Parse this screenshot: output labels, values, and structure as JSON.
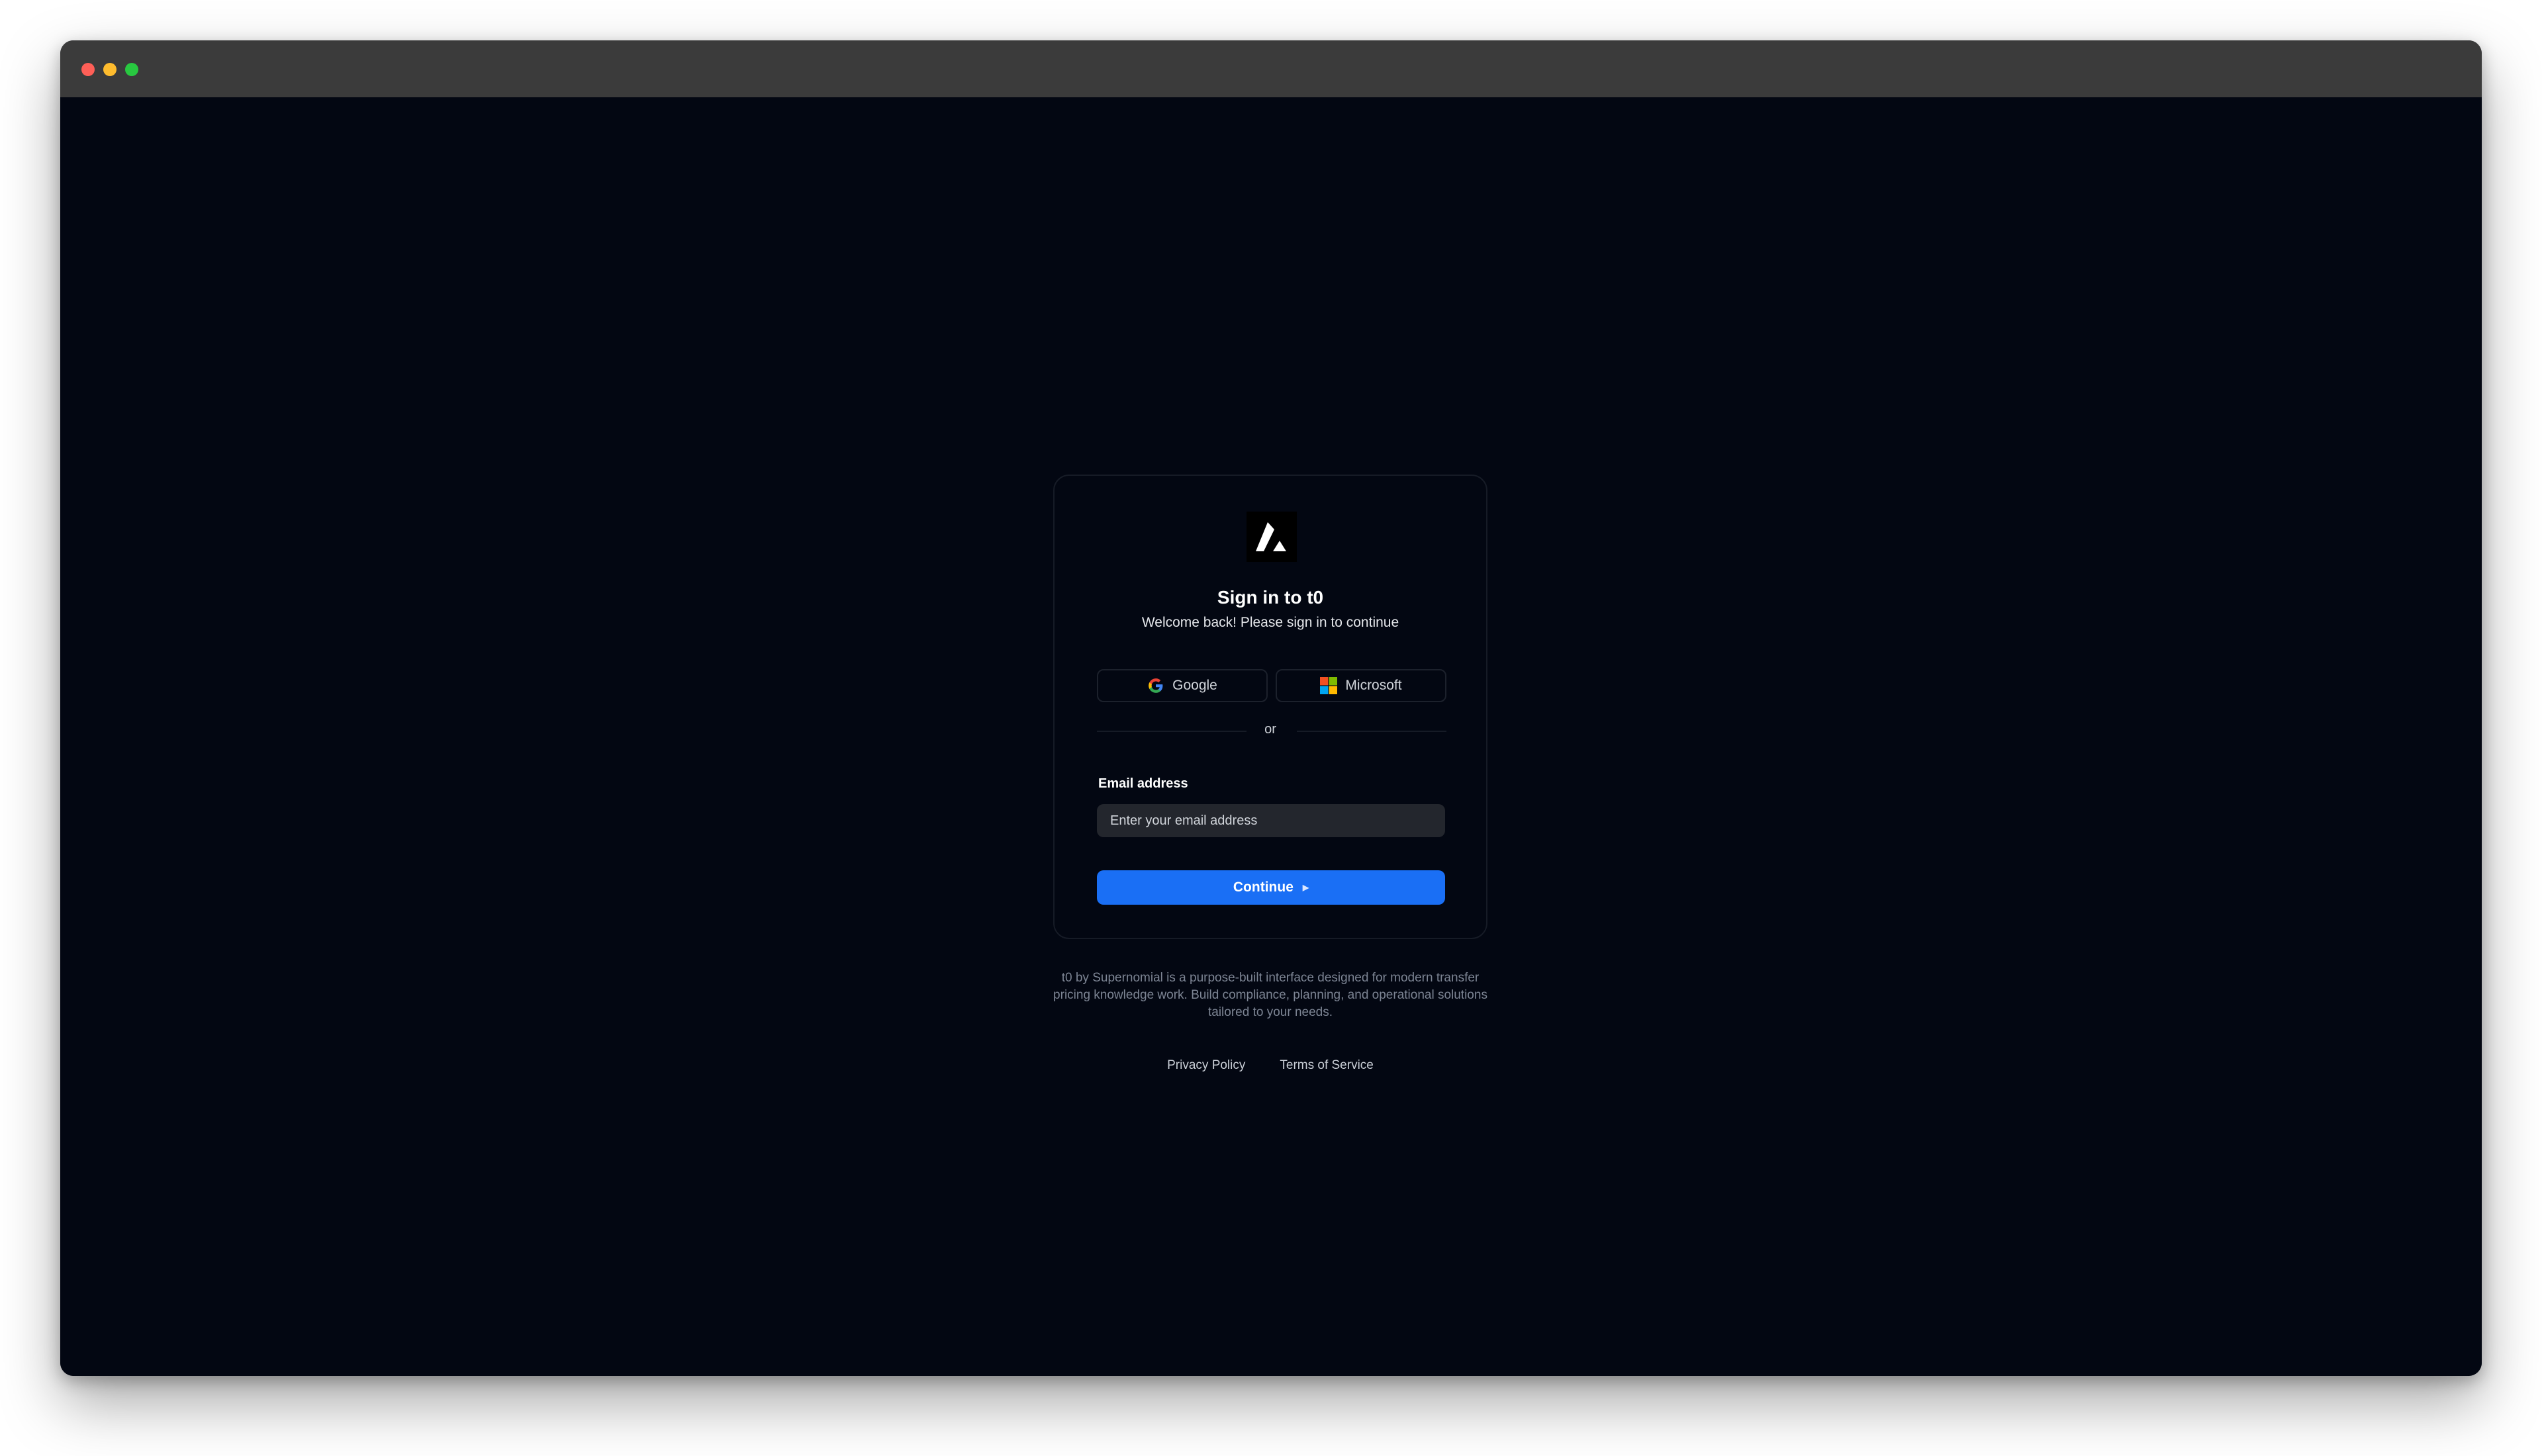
{
  "window": {
    "controls": [
      "close",
      "minimize",
      "maximize"
    ]
  },
  "signin": {
    "logo_icon": "triangle-logo-icon",
    "title": "Sign in to t0",
    "subtitle": "Welcome back! Please sign in to continue",
    "oauth": {
      "google_label": "Google",
      "google_icon": "google-g-icon",
      "microsoft_label": "Microsoft",
      "microsoft_icon": "microsoft-squares-icon"
    },
    "divider_text": "or",
    "email": {
      "label": "Email address",
      "placeholder": "Enter your email address",
      "value": ""
    },
    "continue_label": "Continue",
    "continue_icon": "caret-right-icon"
  },
  "footer": {
    "description": "t0 by Supernomial is a purpose-built interface designed for modern transfer pricing knowledge work. Build compliance, planning, and operational solutions tailored to your needs.",
    "links": {
      "privacy": "Privacy Policy",
      "terms": "Terms of Service"
    }
  },
  "colors": {
    "background": "#030712",
    "titlebar": "#3b3b3b",
    "primary_button": "#1a6ff5",
    "input_background": "#23262d",
    "card_border": "#161b26"
  }
}
